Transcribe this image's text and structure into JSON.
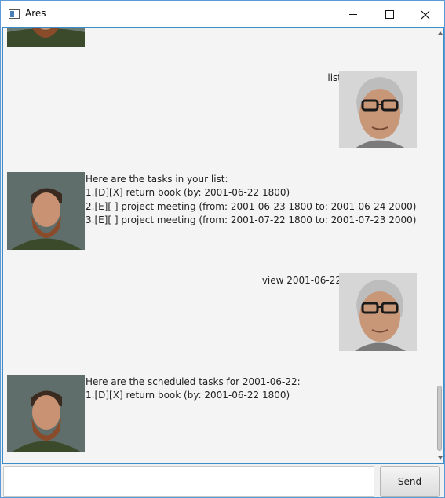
{
  "window": {
    "title": "Ares"
  },
  "messages": [
    {
      "sender": "duke",
      "lines": []
    },
    {
      "sender": "user",
      "text": "list"
    },
    {
      "sender": "duke",
      "lines": [
        "Here are the tasks in your list:",
        "1.[D][X] return book (by: 2001-06-22 1800)",
        "2.[E][ ] project meeting (from: 2001-06-23 1800 to: 2001-06-24 2000)",
        "3.[E][ ] project meeting (from: 2001-07-22 1800 to: 2001-07-23 2000)"
      ]
    },
    {
      "sender": "user",
      "text": "view 2001-06-22"
    },
    {
      "sender": "duke",
      "lines": [
        "Here are the scheduled tasks for 2001-06-22:",
        "1.[D][X] return book (by: 2001-06-22 1800)"
      ]
    }
  ],
  "input": {
    "value": "",
    "placeholder": ""
  },
  "send": {
    "label": "Send"
  }
}
